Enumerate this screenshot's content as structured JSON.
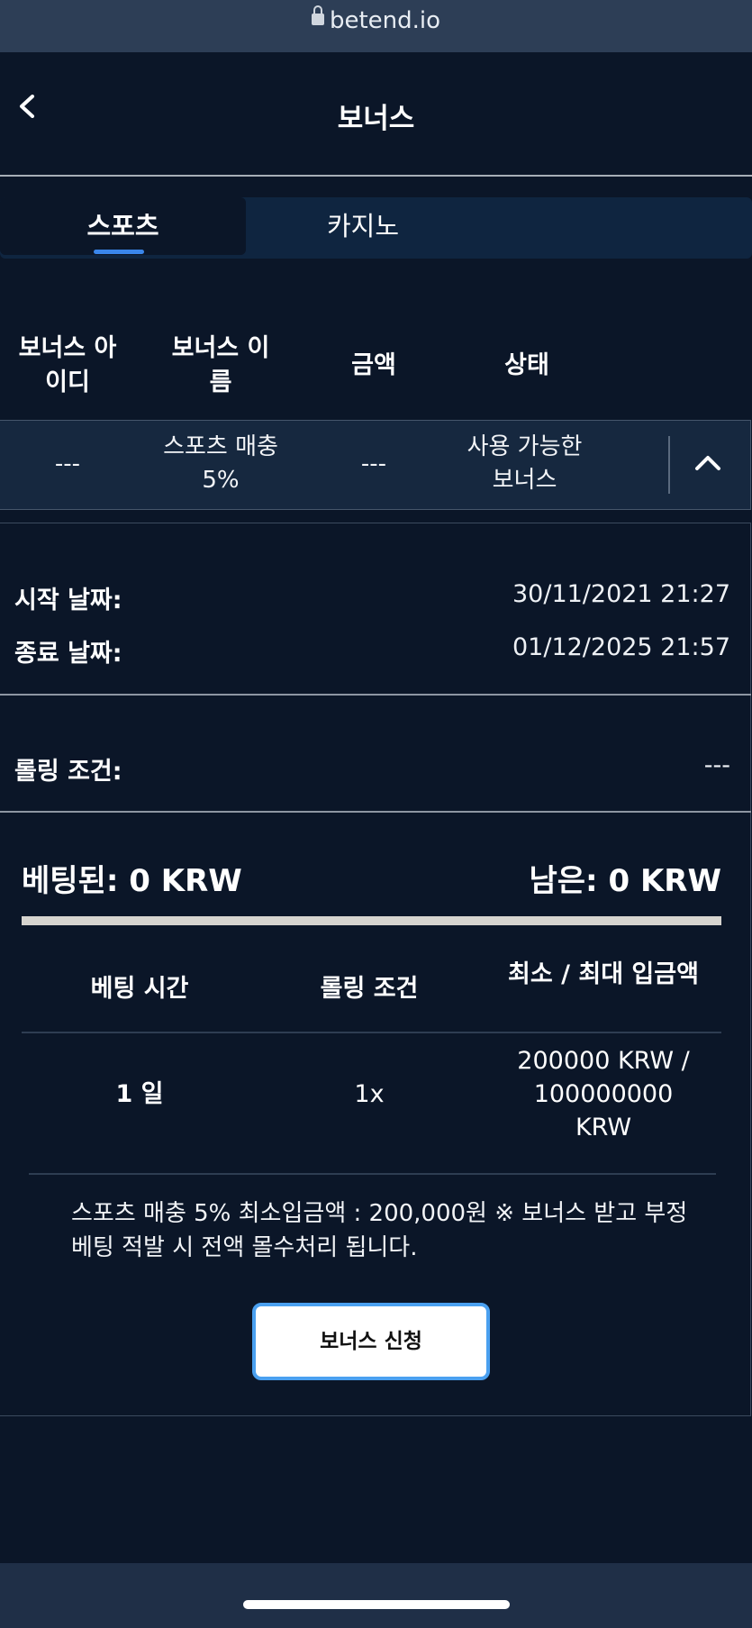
{
  "browser": {
    "url": "betend.io"
  },
  "header": {
    "title": "보너스"
  },
  "tabs": [
    {
      "label": "스포츠",
      "active": true
    },
    {
      "label": "카지노",
      "active": false
    }
  ],
  "table": {
    "headers": [
      "보너스 아이디",
      "보너스 이름",
      "금액",
      "상태"
    ],
    "row": {
      "id": "---",
      "name": "스포츠 매충 5%",
      "amount": "---",
      "status": "사용 가능한 보너스"
    }
  },
  "details": {
    "start_label": "시작 날짜:",
    "start_value": "30/11/2021 21:27",
    "end_label": "종료 날짜:",
    "end_value": "01/12/2025 21:57",
    "rolling_label": "롤링 조건:",
    "rolling_value": "---",
    "bet_label": "베팅된: 0 KRW",
    "remain_label": "남은: 0 KRW",
    "progress_fraction": 0
  },
  "rules_table": {
    "headers": [
      "베팅 시간",
      "롤링 조건",
      "최소 / 최대 입금액"
    ],
    "row": {
      "time": "1 일",
      "rolling": "1x",
      "deposit": "200000 KRW / 100000000 KRW"
    }
  },
  "note": "스포츠 매충 5% 최소입금액 : 200,000원 ※ 보너스 받고 부정 베팅 적발 시 전액 몰수처리 됩니다.",
  "apply_button": "보너스 신청",
  "colors": {
    "background": "#0b1628",
    "accent": "#3a86ea",
    "button_border": "#4aa0f0"
  }
}
